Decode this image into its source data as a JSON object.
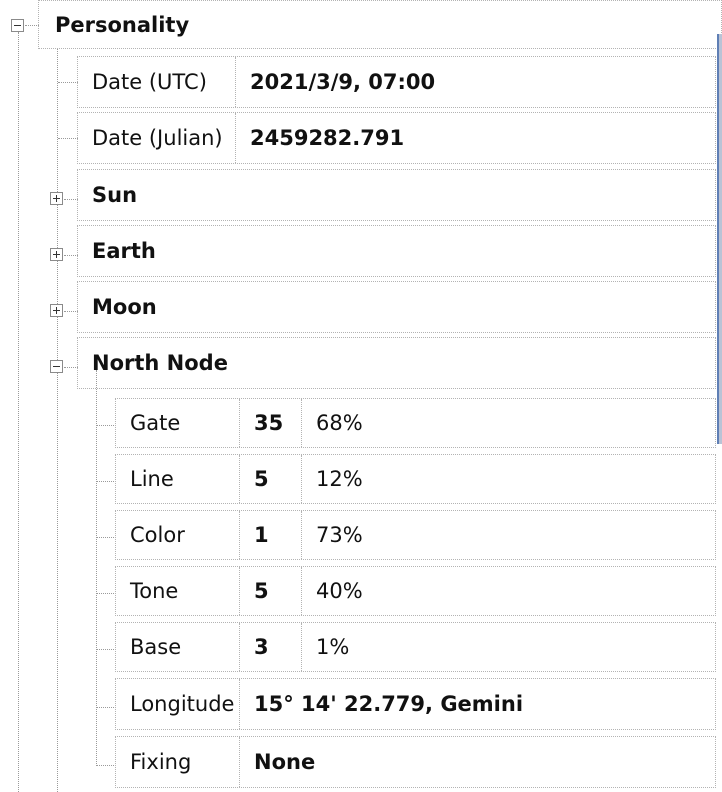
{
  "tree": {
    "root": {
      "label": "Personality",
      "expanded": true
    },
    "items": [
      {
        "key": "date_utc",
        "label": "Date (UTC)",
        "value": "2021/3/9, 07:00"
      },
      {
        "key": "date_julian",
        "label": "Date (Julian)",
        "value": "2459282.791"
      },
      {
        "key": "sun",
        "label": "Sun",
        "expanded": false
      },
      {
        "key": "earth",
        "label": "Earth",
        "expanded": false
      },
      {
        "key": "moon",
        "label": "Moon",
        "expanded": false
      },
      {
        "key": "north_node",
        "label": "North Node",
        "expanded": true
      }
    ],
    "north_node_children": [
      {
        "label": "Gate",
        "value": "35",
        "percent": "68%"
      },
      {
        "label": "Line",
        "value": "5",
        "percent": "12%"
      },
      {
        "label": "Color",
        "value": "1",
        "percent": "73%"
      },
      {
        "label": "Tone",
        "value": "5",
        "percent": "40%"
      },
      {
        "label": "Base",
        "value": "3",
        "percent": "1%"
      },
      {
        "label": "Longitude",
        "value": "15° 14' 22.779, Gemini"
      },
      {
        "label": "Fixing",
        "value": "None"
      }
    ]
  },
  "icons": {
    "expand": "plus-box-icon",
    "collapse": "minus-box-icon"
  }
}
